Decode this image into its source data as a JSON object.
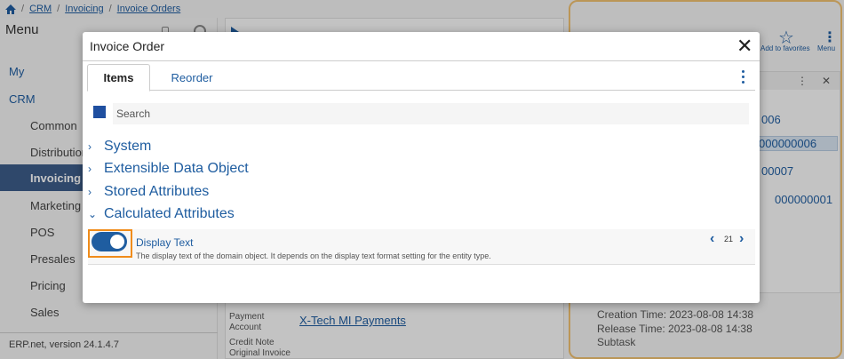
{
  "breadcrumb": [
    "CRM",
    "Invoicing",
    "Invoice Orders"
  ],
  "sidebar": {
    "title": "Menu",
    "items": [
      {
        "label": "My",
        "level": "top"
      },
      {
        "label": "CRM",
        "level": "top"
      },
      {
        "label": "Common",
        "level": "sub"
      },
      {
        "label": "Distribution",
        "level": "sub"
      },
      {
        "label": "Invoicing",
        "level": "sub",
        "active": true
      },
      {
        "label": "Marketing",
        "level": "sub"
      },
      {
        "label": "POS",
        "level": "sub"
      },
      {
        "label": "Presales",
        "level": "sub"
      },
      {
        "label": "Pricing",
        "level": "sub"
      },
      {
        "label": "Sales",
        "level": "sub"
      }
    ],
    "footer": "ERP.net, version 24.1.4.7"
  },
  "main_panel": {
    "payment_account_label": "Payment Account",
    "payment_account_value": "X-Tech MI Payments",
    "credit_note_label": "Credit Note",
    "original_invoice_label": "Original Invoice"
  },
  "right_panel": {
    "favorites_label": "Add to favorites",
    "menu_label": "Menu",
    "numbers": [
      "006",
      "000000006",
      "00007",
      "000000001"
    ],
    "creation_time": "Creation Time: 2023-08-08 14:38",
    "release_time": "Release Time: 2023-08-08 14:38",
    "subtask": "Subtask"
  },
  "dialog": {
    "title": "Invoice Order",
    "tabs": [
      {
        "label": "Items"
      },
      {
        "label": "Reorder"
      }
    ],
    "search_placeholder": "Search",
    "tree": [
      {
        "label": "System",
        "expanded": false
      },
      {
        "label": "Extensible Data Object",
        "expanded": false
      },
      {
        "label": "Stored Attributes",
        "expanded": false
      },
      {
        "label": "Calculated Attributes",
        "expanded": true
      }
    ],
    "attribute": {
      "name": "Display Text",
      "description": "The display text of the domain object. It depends on the display text format setting for the entity type.",
      "enabled": true,
      "page": "21"
    }
  },
  "colors": {
    "accent": "#1f5da0",
    "highlight": "#f08c1a",
    "active_nav": "#3d5d8a"
  }
}
